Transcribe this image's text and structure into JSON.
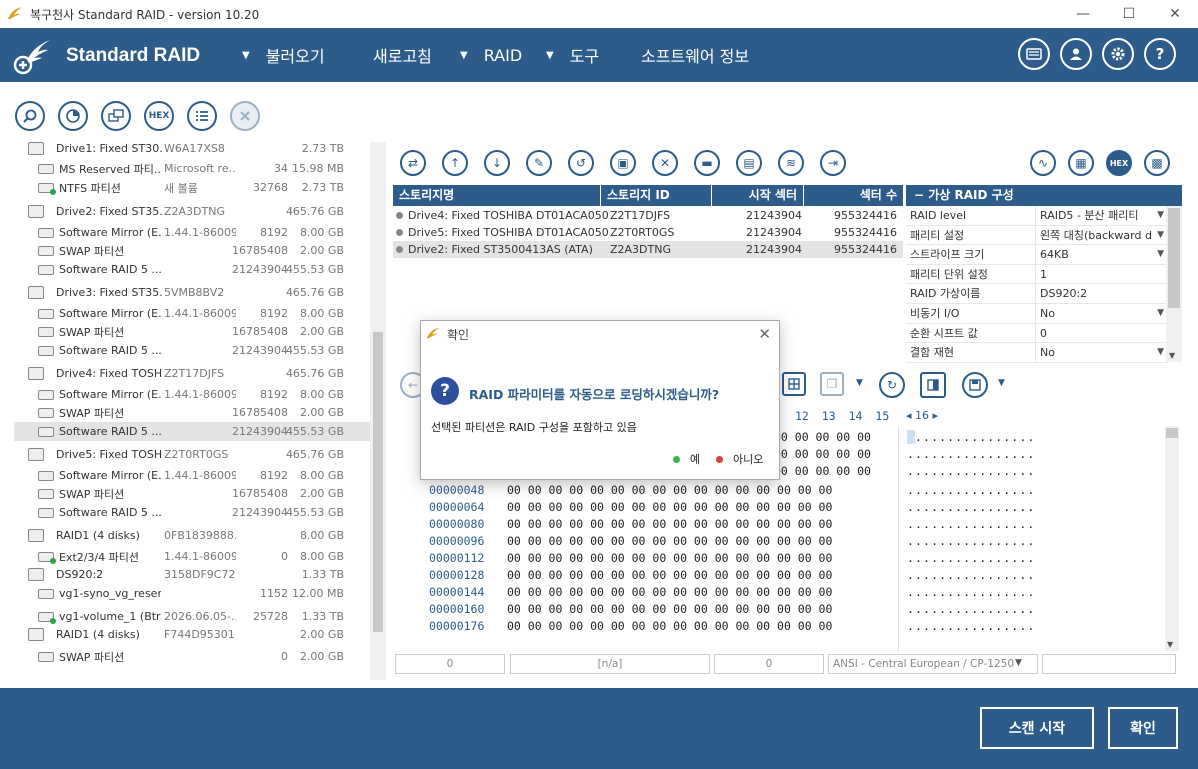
{
  "window": {
    "title": "복구천사 Standard RAID - version 10.20",
    "minimize": "—",
    "maximize": "☐",
    "close": "✕"
  },
  "header": {
    "brand": "Standard RAID",
    "menu": [
      "불러오기",
      "새로고침",
      "RAID",
      "도구",
      "소프트웨어 정보"
    ],
    "menu_arrows": [
      "▼",
      "▼",
      "▼"
    ],
    "accent": "#2d5c8a"
  },
  "toolbar": {
    "hex_label": "HEX"
  },
  "tree": [
    {
      "name": "Drive1: Fixed ST30...",
      "id": "W6A17XS8",
      "start": "",
      "size": "2.73 TB",
      "type": "disk"
    },
    {
      "name": "MS Reserved 파티...",
      "id": "Microsoft re...",
      "start": "34",
      "size": "15.98 MB",
      "type": "part"
    },
    {
      "name": "NTFS 파티션",
      "id": "새 볼륨",
      "start": "32768",
      "size": "2.73 TB",
      "type": "part-ok"
    },
    {
      "name": "Drive2: Fixed ST35...",
      "id": "Z2A3DTNG",
      "start": "",
      "size": "465.76 GB",
      "type": "disk"
    },
    {
      "name": "Software Mirror (E...",
      "id": "1.44.1-86009",
      "start": "8192",
      "size": "8.00 GB",
      "type": "part"
    },
    {
      "name": "SWAP 파티션",
      "id": "",
      "start": "16785408",
      "size": "2.00 GB",
      "type": "part"
    },
    {
      "name": "Software RAID 5 ...",
      "id": "",
      "start": "21243904",
      "size": "455.53 GB",
      "type": "part"
    },
    {
      "name": "Drive3: Fixed ST35...",
      "id": "5VMB8BV2",
      "start": "",
      "size": "465.76 GB",
      "type": "disk"
    },
    {
      "name": "Software Mirror (E...",
      "id": "1.44.1-86009",
      "start": "8192",
      "size": "8.00 GB",
      "type": "part"
    },
    {
      "name": "SWAP 파티션",
      "id": "",
      "start": "16785408",
      "size": "2.00 GB",
      "type": "part"
    },
    {
      "name": "Software RAID 5 ...",
      "id": "",
      "start": "21243904",
      "size": "455.53 GB",
      "type": "part"
    },
    {
      "name": "Drive4: Fixed TOSH...",
      "id": "Z2T17DJFS",
      "start": "",
      "size": "465.76 GB",
      "type": "disk"
    },
    {
      "name": "Software Mirror (E...",
      "id": "1.44.1-86009",
      "start": "8192",
      "size": "8.00 GB",
      "type": "part"
    },
    {
      "name": "SWAP 파티션",
      "id": "",
      "start": "16785408",
      "size": "2.00 GB",
      "type": "part"
    },
    {
      "name": "Software RAID 5 ...",
      "id": "",
      "start": "21243904",
      "size": "455.53 GB",
      "type": "part",
      "selected": true
    },
    {
      "name": "Drive5: Fixed TOSH...",
      "id": "Z2T0RT0GS",
      "start": "",
      "size": "465.76 GB",
      "type": "disk"
    },
    {
      "name": "Software Mirror (E...",
      "id": "1.44.1-86009",
      "start": "8192",
      "size": "8.00 GB",
      "type": "part"
    },
    {
      "name": "SWAP 파티션",
      "id": "",
      "start": "16785408",
      "size": "2.00 GB",
      "type": "part"
    },
    {
      "name": "Software RAID 5 ...",
      "id": "",
      "start": "21243904",
      "size": "455.53 GB",
      "type": "part"
    },
    {
      "name": "RAID1 (4 disks)",
      "id": "0FB1839888...",
      "start": "",
      "size": "8.00 GB",
      "type": "raid"
    },
    {
      "name": "Ext2/3/4 파티션",
      "id": "1.44.1-86009",
      "start": "0",
      "size": "8.00 GB",
      "type": "part-ok"
    },
    {
      "name": "DS920:2",
      "id": "3158DF9C72...",
      "start": "",
      "size": "1.33 TB",
      "type": "raid"
    },
    {
      "name": "vg1-syno_vg_reser...",
      "id": "",
      "start": "1152",
      "size": "12.00 MB",
      "type": "part"
    },
    {
      "name": "vg1-volume_1 (Btr...",
      "id": "2026.06.05-...",
      "start": "25728",
      "size": "1.33 TB",
      "type": "part-ok"
    },
    {
      "name": "RAID1 (4 disks)",
      "id": "F744D95301...",
      "start": "",
      "size": "2.00 GB",
      "type": "raid"
    },
    {
      "name": "SWAP 파티션",
      "id": "",
      "start": "0",
      "size": "2.00 GB",
      "type": "part"
    }
  ],
  "storage_table": {
    "headers": [
      "스토리지명",
      "스토리지 ID",
      "시작 섹터",
      "섹터 수"
    ],
    "rows": [
      {
        "name": "Drive4: Fixed TOSHIBA DT01ACA050 ...",
        "id": "Z2T17DJFS",
        "start": "21243904",
        "count": "955324416"
      },
      {
        "name": "Drive5: Fixed TOSHIBA DT01ACA050 ...",
        "id": "Z2T0RT0GS",
        "start": "21243904",
        "count": "955324416"
      },
      {
        "name": "Drive2: Fixed ST3500413AS (ATA)",
        "id": "Z2A3DTNG",
        "start": "21243904",
        "count": "955324416",
        "selected": true
      }
    ]
  },
  "virtual_raid": {
    "title": "−  가상 RAID 구성",
    "rows": [
      {
        "k": "RAID level",
        "v": "RAID5 - 분산 패리티",
        "dd": true
      },
      {
        "k": "패리티 설정",
        "v": "왼쪽 대칭(backward d",
        "dd": true
      },
      {
        "k": "스트라이프 크기",
        "v": "64KB",
        "dd": true
      },
      {
        "k": "패리티 단위 설정",
        "v": "1",
        "dd": false
      },
      {
        "k": "RAID 가상이름",
        "v": "DS920:2",
        "dd": false
      },
      {
        "k": "비동기 I/O",
        "v": "No",
        "dd": true
      },
      {
        "k": "순환 시프트 값",
        "v": "0",
        "dd": false
      },
      {
        "k": "결함 재현",
        "v": "No",
        "dd": true
      }
    ]
  },
  "hex": {
    "col_header": [
      "12",
      "13",
      "14",
      "15"
    ],
    "nav": "◂  16  ▸",
    "addresses": [
      "00000048",
      "00000064",
      "00000080",
      "00000096",
      "00000112",
      "00000128",
      "00000144",
      "00000160",
      "00000176"
    ],
    "row_bytes": "00 00 00 00 00 00 00 00 00 00 00 00 00 00 00 00",
    "row_bytes_partial": "00 00 00 00 00",
    "ascii": "................"
  },
  "statusbar": [
    "0",
    "[n/a]",
    "0",
    "ANSI - Central European / CP-1250",
    ""
  ],
  "footer": {
    "scan": "스캔 시작",
    "ok": "확인"
  },
  "dialog": {
    "title": "확인",
    "question": "RAID 파라미터를 자동으로 로딩하시겠습니까?",
    "message": "선택된 파티션은 RAID 구성을 포함하고 있음",
    "yes": "예",
    "no": "아니오",
    "yes_color": "#3db24a",
    "no_color": "#d9433f"
  }
}
